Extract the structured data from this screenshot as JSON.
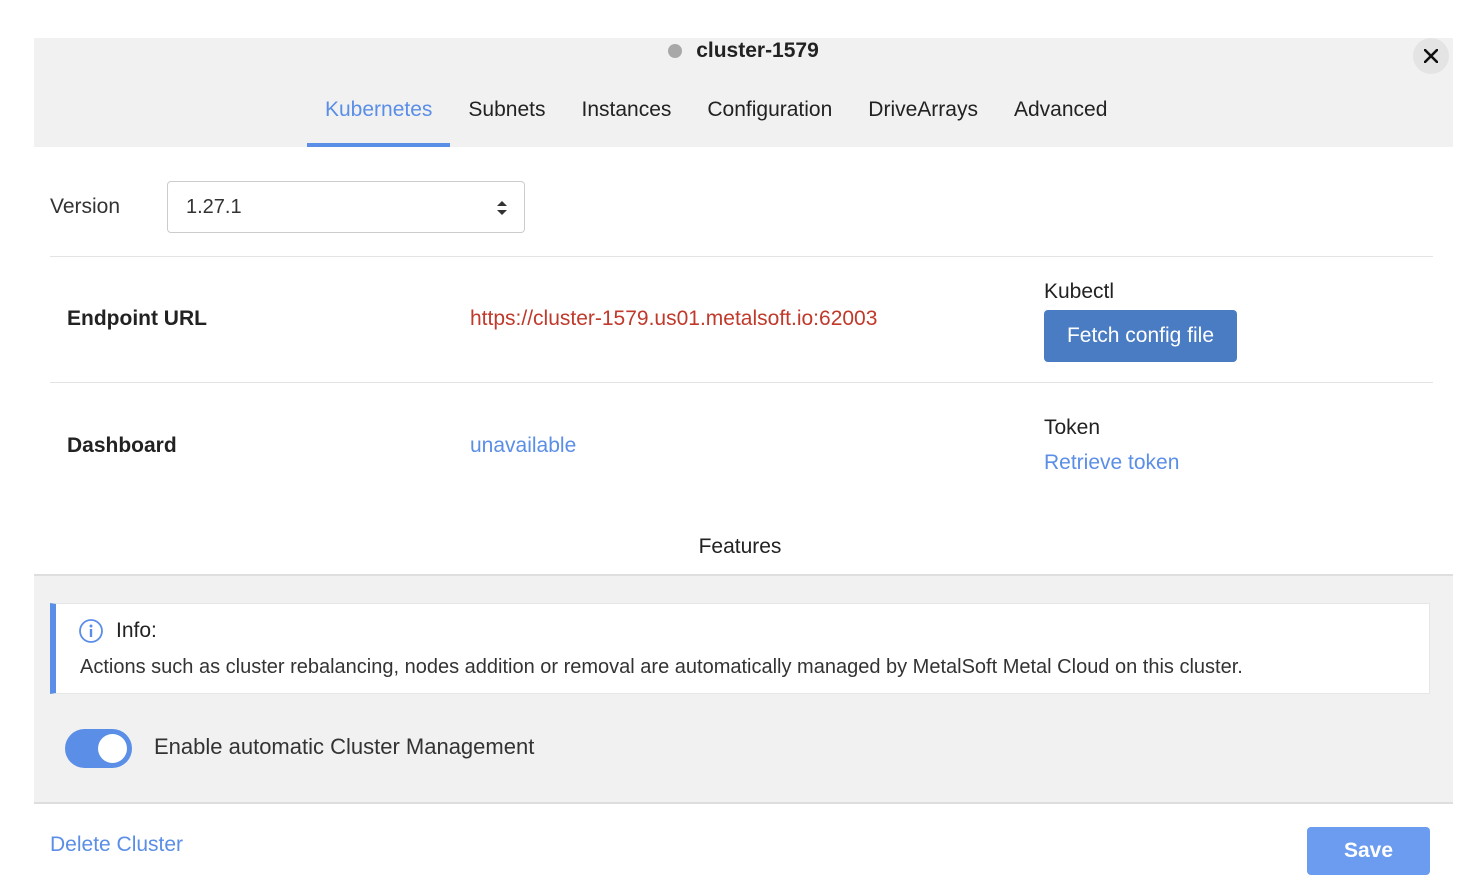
{
  "header": {
    "cluster_name": "cluster-1579",
    "status_color": "#a8a8a8",
    "close_icon": "close-icon"
  },
  "tabs": [
    {
      "label": "Kubernetes",
      "active": true
    },
    {
      "label": "Subnets",
      "active": false
    },
    {
      "label": "Instances",
      "active": false
    },
    {
      "label": "Configuration",
      "active": false
    },
    {
      "label": "DriveArrays",
      "active": false
    },
    {
      "label": "Advanced",
      "active": false
    }
  ],
  "version": {
    "label": "Version",
    "selected": "1.27.1"
  },
  "endpoint": {
    "label": "Endpoint URL",
    "url": "https://cluster-1579.us01.metalsoft.io:62003",
    "kubectl_label": "Kubectl",
    "fetch_button": "Fetch config file"
  },
  "dashboard": {
    "label": "Dashboard",
    "value": "unavailable",
    "token_label": "Token",
    "token_link": "Retrieve token"
  },
  "features": {
    "title": "Features",
    "info_title": "Info:",
    "info_text": "Actions such as cluster rebalancing, nodes addition or removal are automatically managed by MetalSoft Metal Cloud on this cluster.",
    "toggle_label": "Enable automatic Cluster Management",
    "toggle_on": true
  },
  "footer": {
    "delete_label": "Delete Cluster",
    "save_label": "Save"
  },
  "colors": {
    "accent": "#5b8ee6",
    "button_dark": "#4a7cc4",
    "url_red": "#c0392b"
  }
}
